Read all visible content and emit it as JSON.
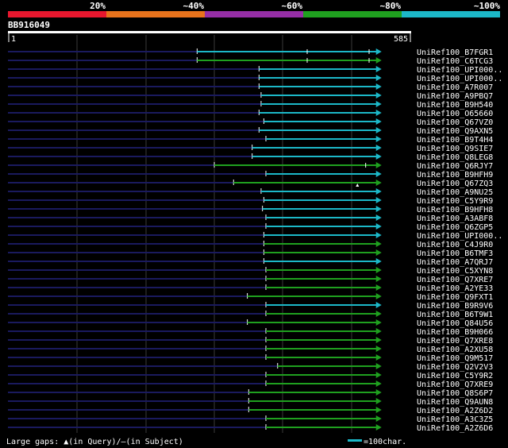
{
  "legend_scale": {
    "segments": [
      {
        "label": "20%",
        "color": "#e8172e"
      },
      {
        "label": "~40%",
        "color": "#e8731c"
      },
      {
        "label": "~60%",
        "color": "#962ea6"
      },
      {
        "label": "~80%",
        "color": "#1fa01f"
      },
      {
        "label": "~100%",
        "color": "#1cb8c8"
      }
    ]
  },
  "query": {
    "name": "BB916049",
    "start": "1",
    "end": "585"
  },
  "colors": {
    "query_track": "#1a1a5e",
    "grid": "#3a3a3a",
    "cyan": "#1cb8c8",
    "green": "#1fa01f",
    "label_text": "#ffffff"
  },
  "hits": [
    {
      "name": "UniRef100_B7FGR1",
      "start": 275,
      "end": 542,
      "color": "cyan",
      "inner_ticks": [
        435,
        525
      ]
    },
    {
      "name": "UniRef100_C6TCG3",
      "start": 275,
      "end": 542,
      "color": "green",
      "inner_ticks": [
        435,
        525
      ]
    },
    {
      "name": "UniRef100_UPI000..",
      "start": 365,
      "end": 542,
      "color": "cyan"
    },
    {
      "name": "UniRef100_UPI000..",
      "start": 365,
      "end": 542,
      "color": "cyan"
    },
    {
      "name": "UniRef100_A7R007",
      "start": 365,
      "end": 542,
      "color": "cyan"
    },
    {
      "name": "UniRef100_A9PBQ7",
      "start": 368,
      "end": 542,
      "color": "cyan"
    },
    {
      "name": "UniRef100_B9H540",
      "start": 368,
      "end": 542,
      "color": "cyan"
    },
    {
      "name": "UniRef100_O65660",
      "start": 365,
      "end": 542,
      "color": "cyan"
    },
    {
      "name": "UniRef100_Q67VZ0",
      "start": 372,
      "end": 542,
      "color": "cyan"
    },
    {
      "name": "UniRef100_Q9AXN5",
      "start": 365,
      "end": 542,
      "color": "cyan"
    },
    {
      "name": "UniRef100_B9T4H4",
      "start": 375,
      "end": 542,
      "color": "cyan"
    },
    {
      "name": "UniRef100_Q9SIE7",
      "start": 355,
      "end": 542,
      "color": "cyan"
    },
    {
      "name": "UniRef100_Q8LEG8",
      "start": 355,
      "end": 542,
      "color": "cyan"
    },
    {
      "name": "UniRef100_Q6RJY7",
      "start": 300,
      "end": 542,
      "color": "green",
      "inner_ticks": [
        520
      ]
    },
    {
      "name": "UniRef100_B9HFH9",
      "start": 375,
      "end": 542,
      "color": "cyan"
    },
    {
      "name": "UniRef100_Q67ZQ3",
      "start": 328,
      "end": 542,
      "color": "green",
      "gap_mark": 508
    },
    {
      "name": "UniRef100_A9NU25",
      "start": 368,
      "end": 542,
      "color": "cyan"
    },
    {
      "name": "UniRef100_C5Y9R9",
      "start": 372,
      "end": 542,
      "color": "cyan"
    },
    {
      "name": "UniRef100_B9HFH8",
      "start": 370,
      "end": 542,
      "color": "cyan"
    },
    {
      "name": "UniRef100_A3ABF8",
      "start": 375,
      "end": 542,
      "color": "cyan"
    },
    {
      "name": "UniRef100_Q6ZGP5",
      "start": 375,
      "end": 542,
      "color": "cyan"
    },
    {
      "name": "UniRef100_UPI000..",
      "start": 372,
      "end": 542,
      "color": "cyan"
    },
    {
      "name": "UniRef100_C4J9R0",
      "start": 372,
      "end": 542,
      "color": "green"
    },
    {
      "name": "UniRef100_B6TMF3",
      "start": 372,
      "end": 542,
      "color": "green"
    },
    {
      "name": "UniRef100_A7QRJ7",
      "start": 372,
      "end": 542,
      "color": "cyan"
    },
    {
      "name": "UniRef100_C5XYN8",
      "start": 375,
      "end": 542,
      "color": "green"
    },
    {
      "name": "UniRef100_Q7XRE7",
      "start": 375,
      "end": 542,
      "color": "green"
    },
    {
      "name": "UniRef100_A2YE33",
      "start": 375,
      "end": 542,
      "color": "green"
    },
    {
      "name": "UniRef100_Q9FXT1",
      "start": 348,
      "end": 542,
      "color": "green"
    },
    {
      "name": "UniRef100_B9R9V6",
      "start": 375,
      "end": 542,
      "color": "cyan"
    },
    {
      "name": "UniRef100_B6T9W1",
      "start": 375,
      "end": 542,
      "color": "green"
    },
    {
      "name": "UniRef100_Q84U56",
      "start": 348,
      "end": 542,
      "color": "green"
    },
    {
      "name": "UniRef100_B9H066",
      "start": 375,
      "end": 542,
      "color": "green"
    },
    {
      "name": "UniRef100_Q7XRE8",
      "start": 375,
      "end": 542,
      "color": "green"
    },
    {
      "name": "UniRef100_A2XU58",
      "start": 375,
      "end": 542,
      "color": "green"
    },
    {
      "name": "UniRef100_Q9M517",
      "start": 375,
      "end": 542,
      "color": "green"
    },
    {
      "name": "UniRef100_Q2V2V3",
      "start": 392,
      "end": 542,
      "color": "green"
    },
    {
      "name": "UniRef100_C5Y9R2",
      "start": 375,
      "end": 542,
      "color": "green"
    },
    {
      "name": "UniRef100_Q7XRE9",
      "start": 375,
      "end": 542,
      "color": "green"
    },
    {
      "name": "UniRef100_Q8S6P7",
      "start": 350,
      "end": 542,
      "color": "green"
    },
    {
      "name": "UniRef100_Q9AUN8",
      "start": 350,
      "end": 542,
      "color": "green"
    },
    {
      "name": "UniRef100_A2Z6D2",
      "start": 350,
      "end": 542,
      "color": "green"
    },
    {
      "name": "UniRef100_A3C3Z5",
      "start": 375,
      "end": 542,
      "color": "green"
    },
    {
      "name": "UniRef100_A2Z6D6",
      "start": 375,
      "end": 542,
      "color": "green"
    }
  ],
  "footer": {
    "gaps_prefix": "Large gaps: ",
    "query_gap_symbol": "▲",
    "query_gap_text": "(in Query)/",
    "subject_gap_symbol": "–",
    "subject_gap_text": "(in Subject)",
    "scale_text": "=100char."
  }
}
